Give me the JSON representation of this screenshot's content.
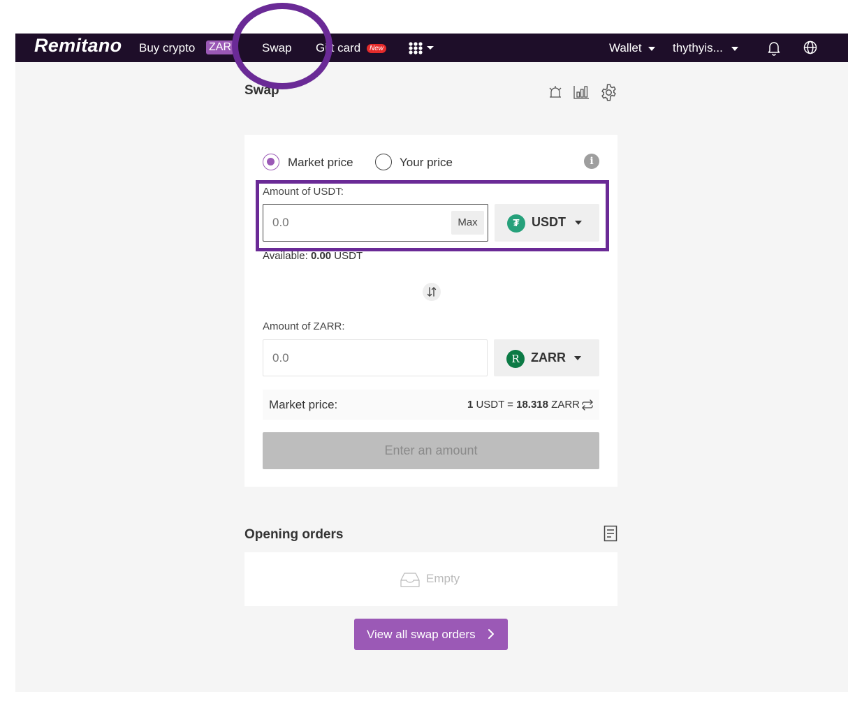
{
  "nav": {
    "logo": "Remitano",
    "buy_crypto": "Buy crypto",
    "zar_badge": "ZAR",
    "swap": "Swap",
    "gift_card": "Gift card",
    "new_badge": "New",
    "wallet": "Wallet",
    "username": "thythyis..."
  },
  "page": {
    "title": "Swap"
  },
  "swap_form": {
    "market_price_option": "Market price",
    "your_price_option": "Your price",
    "selected_option": "Market price",
    "from": {
      "label": "Amount of USDT:",
      "placeholder": "0.0",
      "max_label": "Max",
      "currency": "USDT",
      "available_prefix": "Available: ",
      "available_amount": "0.00",
      "available_unit": " USDT"
    },
    "to": {
      "label": "Amount of ZARR:",
      "placeholder": "0.0",
      "currency": "ZARR"
    },
    "market_price": {
      "label": "Market price:",
      "lhs_amount": "1",
      "lhs_unit": " USDT = ",
      "rhs_amount": "18.318",
      "rhs_unit": " ZARR"
    },
    "submit_label": "Enter an amount"
  },
  "orders": {
    "title": "Opening orders",
    "empty_text": "Empty",
    "view_all_label": "View all swap orders"
  },
  "colors": {
    "navbar": "#1e0e29",
    "brand": "#9b59b6",
    "annotation": "#6a2a96",
    "usdt": "#26a17b",
    "zarr": "#0c7a45"
  }
}
